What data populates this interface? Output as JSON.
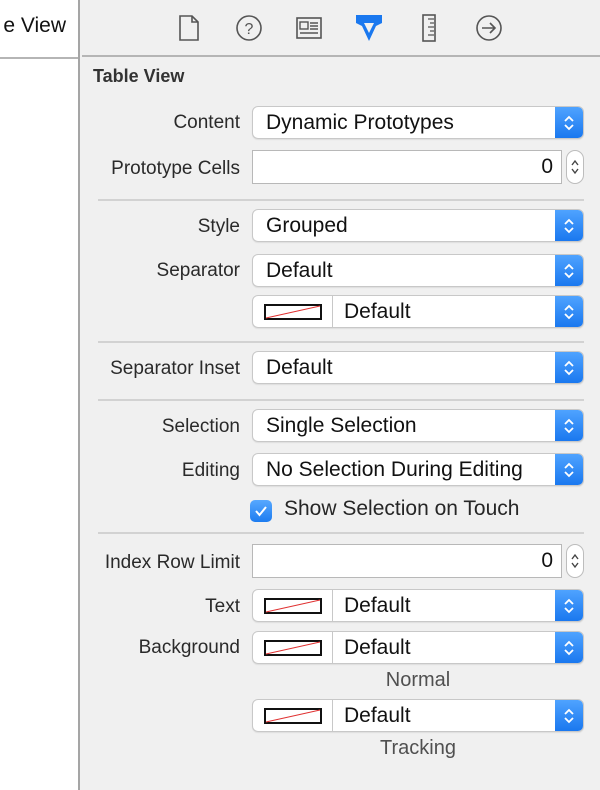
{
  "left_pane": {
    "title": "e View"
  },
  "tabs": [
    {
      "name": "file-inspector",
      "icon": "document-icon"
    },
    {
      "name": "quick-help",
      "icon": "question-icon"
    },
    {
      "name": "identity-inspector",
      "icon": "identity-card-icon"
    },
    {
      "name": "attributes-inspector",
      "icon": "attributes-arrow-icon",
      "active": true
    },
    {
      "name": "size-inspector",
      "icon": "ruler-icon"
    },
    {
      "name": "connections-inspector",
      "icon": "arrow-circle-icon"
    }
  ],
  "accent_color": "#1a78ef",
  "section": {
    "title": "Table View"
  },
  "fields": {
    "content": {
      "label": "Content",
      "value": "Dynamic Prototypes"
    },
    "prototype_cells": {
      "label": "Prototype Cells",
      "value": "0"
    },
    "style": {
      "label": "Style",
      "value": "Grouped"
    },
    "separator": {
      "label": "Separator",
      "value": "Default"
    },
    "separator_color": {
      "value": "Default"
    },
    "separator_inset": {
      "label": "Separator Inset",
      "value": "Default"
    },
    "selection": {
      "label": "Selection",
      "value": "Single Selection"
    },
    "editing": {
      "label": "Editing",
      "value": "No Selection During Editing"
    },
    "show_selection": {
      "label": "Show Selection on Touch",
      "checked": true
    },
    "index_row_limit": {
      "label": "Index Row Limit",
      "value": "0"
    },
    "text": {
      "label": "Text",
      "value": "Default"
    },
    "background": {
      "label": "Background",
      "value": "Default",
      "caption": "Normal"
    },
    "tracking": {
      "value": "Default",
      "caption": "Tracking"
    }
  }
}
